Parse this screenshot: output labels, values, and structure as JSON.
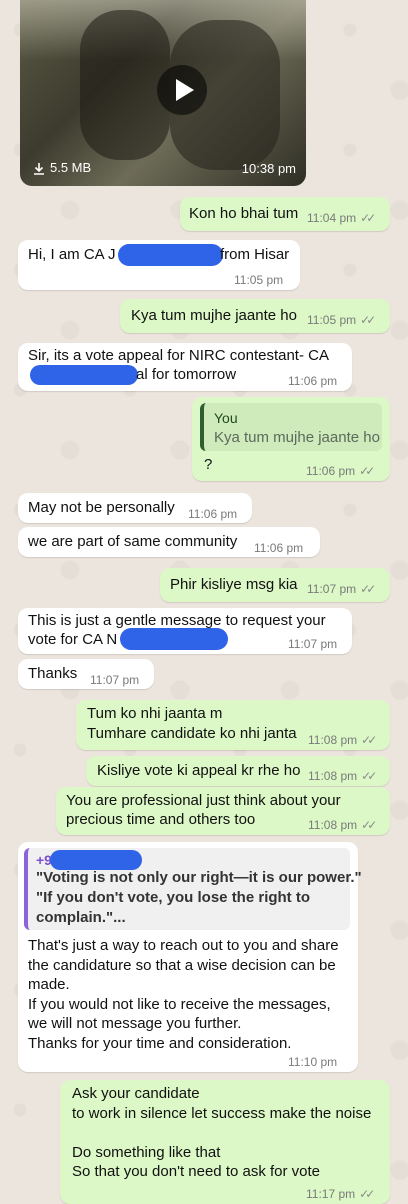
{
  "media": {
    "size": "5.5 MB",
    "time": "10:38 pm"
  },
  "messages": [
    {
      "text": "Kon ho bhai tum",
      "time": "11:04 pm"
    },
    {
      "text_a": "Hi, I am CA J",
      "text_b": "from Hisar",
      "time": "11:05 pm"
    },
    {
      "text": "Kya tum mujhe jaante ho",
      "time": "11:05 pm"
    },
    {
      "line1": "Sir, its a vote appeal for NIRC contestant- CA",
      "line2": "al for tomorrow",
      "time": "11:06 pm"
    },
    {
      "quote_author": "You",
      "quote_text": "Kya tum mujhe jaante ho",
      "text": "?",
      "time": "11:06 pm"
    },
    {
      "text": "May not be personally",
      "time": "11:06 pm"
    },
    {
      "text": "we are part of same community",
      "time": "11:06 pm"
    },
    {
      "text": "Phir kisliye msg kia",
      "time": "11:07 pm"
    },
    {
      "line1": "This is just a gentle message to request your",
      "line2": "vote for CA N",
      "time": "11:07 pm"
    },
    {
      "text": "Thanks",
      "time": "11:07 pm"
    },
    {
      "line1": "Tum ko nhi jaanta m",
      "line2": "Tumhare candidate ko nhi janta",
      "time": "11:08 pm"
    },
    {
      "text": "Kisliye vote ki appeal kr rhe ho",
      "time": "11:08 pm"
    },
    {
      "line1": "You are professional just think about your",
      "line2": "precious time and others too",
      "time": "11:08 pm"
    },
    {
      "quote_author": "+9",
      "quote_line1": "\"Voting is not only our right—it is our power.\"",
      "quote_line2": "\"If you don't vote, you lose the right to",
      "quote_line3": "complain.\"...",
      "body": "That's just a way to reach out to you and share\nthe candidature so that a wise decision can be\nmade.\nIf you would not like to receive the messages,\nwe will not message you further.\nThanks for your time and consideration.",
      "time": "11:10 pm"
    },
    {
      "body": "Ask your candidate\nto work in silence let success make the noise\n\nDo something like that\nSo that you don't need to ask for vote",
      "time": "11:17 pm"
    }
  ],
  "ticks": "✓✓"
}
